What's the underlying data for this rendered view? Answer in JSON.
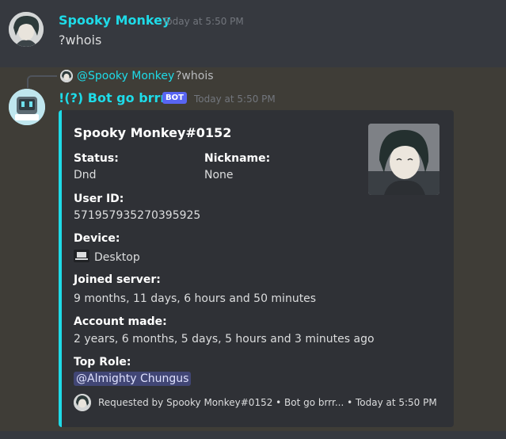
{
  "message_user": {
    "author": "Spooky Monkey",
    "timestamp": "Today at 5:50 PM",
    "content": "?whois"
  },
  "message_bot": {
    "reply_mention": "@Spooky Monkey",
    "reply_text": "?whois",
    "author": "!(?) Bot go brrr...",
    "bot_tag": "BOT",
    "timestamp": "Today at 5:50 PM",
    "embed": {
      "accent_color": "#1edbe8",
      "title": "Spooky Monkey#0152",
      "fields": {
        "status": {
          "name": "Status:",
          "value": "Dnd"
        },
        "nickname": {
          "name": "Nickname:",
          "value": "None"
        },
        "user_id": {
          "name": "User ID:",
          "value": "571957935270395925"
        },
        "device": {
          "name": "Device:",
          "value": "Desktop",
          "icon": "laptop-icon"
        },
        "joined": {
          "name": "Joined server:",
          "value": "9 months, 11 days, 6 hours and 50 minutes"
        },
        "account": {
          "name": "Account made:",
          "value": "2 years, 6 months, 5 days, 5 hours and 3 minutes ago"
        },
        "top_role": {
          "name": "Top Role:",
          "value": "@Almighty Chungus"
        }
      },
      "footer": "Requested by Spooky Monkey#0152 • Bot go brrr... • Today at 5:50 PM"
    }
  }
}
